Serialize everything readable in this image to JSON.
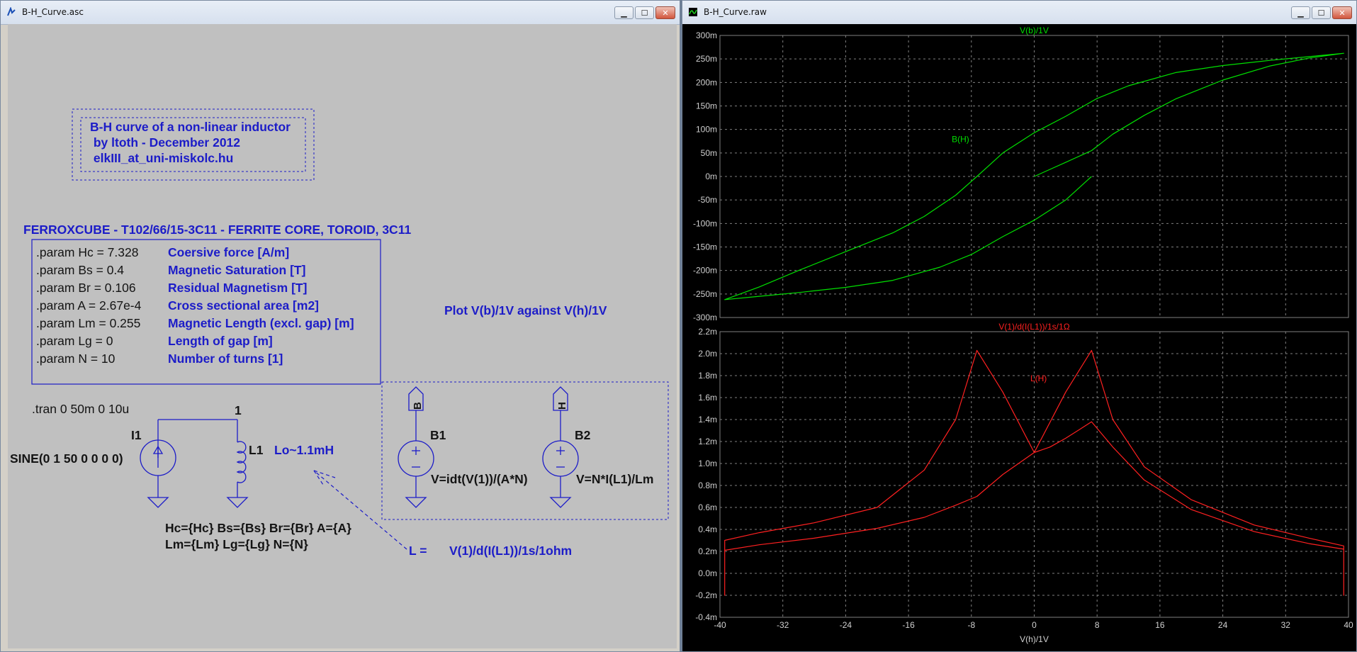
{
  "schematic": {
    "title": "B-H_Curve.asc",
    "comment_lines": [
      "B-H curve of a non-linear inductor",
      " by ltoth - December 2012",
      " elkIII_at_uni-miskolc.hu"
    ],
    "core_title": "FERROXCUBE - T102/66/15-3C11 - FERRITE CORE, TOROID, 3C11",
    "params": [
      {
        "code": ".param Hc = 7.328",
        "desc": "Coersive force [A/m]"
      },
      {
        "code": ".param Bs = 0.4",
        "desc": "Magnetic Saturation [T]"
      },
      {
        "code": ".param Br = 0.106",
        "desc": "Residual Magnetism [T]"
      },
      {
        "code": ".param A = 2.67e-4",
        "desc": "Cross sectional area [m2]"
      },
      {
        "code": ".param Lm = 0.255",
        "desc": "Magnetic Length (excl. gap) [m]"
      },
      {
        "code": ".param Lg = 0",
        "desc": "Length of gap [m]"
      },
      {
        "code": ".param N = 10",
        "desc": "Number of turns [1]"
      }
    ],
    "plot_note": "Plot V(b)/1V against V(h)/1V",
    "tran": ".tran 0 50m 0 10u",
    "node1": "1",
    "i1_name": "I1",
    "i1_value": "SINE(0 1 50 0 0 0 0)",
    "l1_name": "L1",
    "l1_note": "Lo~1.1mH",
    "l1_attr1": "Hc={Hc} Bs={Bs} Br={Br} A={A}",
    "l1_attr2": "Lm={Lm} Lg={Lg} N={N}",
    "l_eq_label": "L =",
    "l_eq": "V(1)/d(I(L1))/1s/1ohm",
    "b1_label": "B",
    "b1_name": "B1",
    "b1_expr": "V=idt(V(1))/(A*N)",
    "b2_label": "H",
    "b2_name": "B2",
    "b2_expr": "V=N*I(L1)/Lm"
  },
  "waveform": {
    "title": "B-H_Curve.raw",
    "top_pane_title": "V(b)/1V",
    "top_trace_label": "B(H)",
    "bottom_pane_title": "V(1)/d(I(L1))/1s/1Ω",
    "bottom_trace_label": "L(H)",
    "xlabel": "V(h)/1V",
    "top_yticks": [
      "300m",
      "250m",
      "200m",
      "150m",
      "100m",
      "50m",
      "0m",
      "-50m",
      "-100m",
      "-150m",
      "-200m",
      "-250m",
      "-300m"
    ],
    "bottom_yticks": [
      "2.2m",
      "2.0m",
      "1.8m",
      "1.6m",
      "1.4m",
      "1.2m",
      "1.0m",
      "0.8m",
      "0.6m",
      "0.4m",
      "0.2m",
      "0.0m",
      "-0.2m",
      "-0.4m"
    ],
    "xticks": [
      "-40",
      "-32",
      "-24",
      "-16",
      "-8",
      "0",
      "8",
      "16",
      "24",
      "32",
      "40"
    ],
    "colors": {
      "top_trace": "#00e000",
      "bottom_trace": "#ff2020",
      "grid": "#808080"
    }
  },
  "chart_data": [
    {
      "type": "line",
      "title": "V(b)/1V",
      "xlabel": "V(h)/1V",
      "ylabel": "",
      "xlim": [
        -40,
        40
      ],
      "ylim": [
        -0.3,
        0.3
      ],
      "grid": true,
      "series": [
        {
          "name": "B(H)",
          "x": [
            0,
            2,
            4,
            7.3,
            10,
            14,
            18,
            24,
            30,
            35,
            39.4,
            35,
            30,
            24,
            18,
            12,
            8,
            4,
            0,
            -4,
            -7.3,
            -10,
            -14,
            -18,
            -24,
            -30,
            -35,
            -39.4,
            -35,
            -30,
            -24,
            -18,
            -12,
            -8,
            -4,
            0,
            4,
            7.3
          ],
          "y": [
            0,
            0.015,
            0.03,
            0.055,
            0.09,
            0.13,
            0.165,
            0.205,
            0.235,
            0.252,
            0.262,
            0.255,
            0.247,
            0.236,
            0.221,
            0.193,
            0.166,
            0.128,
            0.093,
            0.05,
            0.0,
            -0.04,
            -0.085,
            -0.12,
            -0.16,
            -0.2,
            -0.235,
            -0.262,
            -0.255,
            -0.247,
            -0.236,
            -0.221,
            -0.193,
            -0.166,
            -0.128,
            -0.093,
            -0.05,
            0.0
          ]
        }
      ]
    },
    {
      "type": "line",
      "title": "V(1)/d(I(L1))/1s/1Ω",
      "xlabel": "V(h)/1V",
      "ylabel": "",
      "xlim": [
        -40,
        40
      ],
      "ylim": [
        -0.0004,
        0.0022
      ],
      "grid": true,
      "series": [
        {
          "name": "L(H)",
          "x": [
            0,
            2,
            4,
            6,
            7.3,
            10,
            14,
            20,
            28,
            35,
            39.4,
            39.4,
            39.4,
            35,
            28,
            20,
            14,
            10,
            7.3,
            4,
            0,
            -4,
            -7.3,
            -10,
            -14,
            -20,
            -28,
            -35,
            -39.4,
            -39.4,
            -39.4,
            -35,
            -28,
            -20,
            -14,
            -10,
            -7.3,
            -4,
            0
          ],
          "y": [
            0.0011,
            0.00115,
            0.00123,
            0.00132,
            0.00138,
            0.00115,
            0.00085,
            0.00058,
            0.00038,
            0.00027,
            0.00022,
            -0.0002,
            0.00025,
            0.00032,
            0.00044,
            0.00067,
            0.00097,
            0.0014,
            0.00203,
            0.00165,
            0.0011,
            0.0009,
            0.0007,
            0.00062,
            0.00051,
            0.00041,
            0.00032,
            0.00026,
            0.00021,
            -0.0002,
            0.0003,
            0.00037,
            0.00046,
            0.0006,
            0.00094,
            0.0014,
            0.00203,
            0.00165,
            0.0011
          ]
        }
      ]
    }
  ]
}
